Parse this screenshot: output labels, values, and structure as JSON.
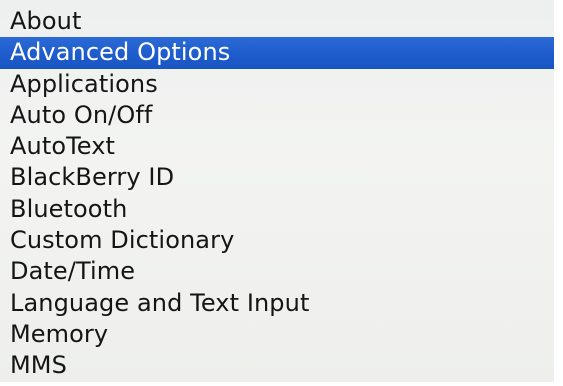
{
  "settings_menu": {
    "selected_index": 1,
    "colors": {
      "selection_background": "#1e5ccc",
      "selection_text": "#ffffff",
      "text": "#151515",
      "background": "#f1f2f0"
    },
    "items": [
      {
        "label": "About"
      },
      {
        "label": "Advanced Options"
      },
      {
        "label": "Applications"
      },
      {
        "label": "Auto On/Off"
      },
      {
        "label": "AutoText"
      },
      {
        "label": "BlackBerry ID"
      },
      {
        "label": "Bluetooth"
      },
      {
        "label": "Custom Dictionary"
      },
      {
        "label": "Date/Time"
      },
      {
        "label": "Language and Text Input"
      },
      {
        "label": "Memory"
      },
      {
        "label": "MMS"
      }
    ]
  }
}
